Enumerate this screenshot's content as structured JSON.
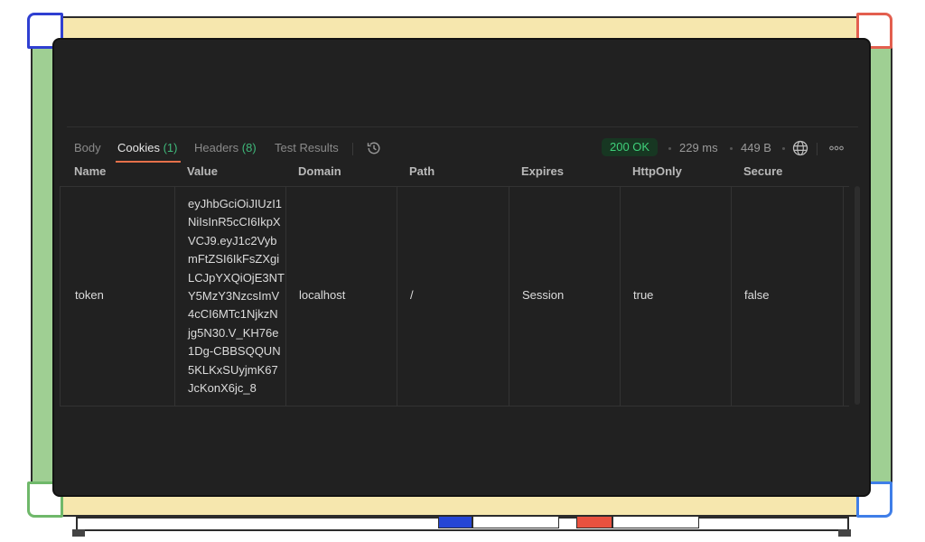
{
  "tabs": [
    {
      "label": "Body",
      "count": ""
    },
    {
      "label": "Cookies",
      "count": "(1)"
    },
    {
      "label": "Headers",
      "count": "(8)"
    },
    {
      "label": "Test Results",
      "count": ""
    }
  ],
  "response": {
    "status": "200 OK",
    "time": "229 ms",
    "size": "449 B"
  },
  "icons": {
    "history": "history-icon",
    "globe": "globe-icon",
    "more": "more-icon"
  },
  "colors": {
    "status_text": "#3fd07a",
    "status_bg": "#173722",
    "accent_underline": "#e5704a",
    "count": "#3fb87a"
  },
  "table": {
    "columns": [
      "Name",
      "Value",
      "Domain",
      "Path",
      "Expires",
      "HttpOnly",
      "Secure"
    ],
    "rows": [
      {
        "name": "token",
        "value_lines": [
          "eyJhbGciOiJIUzI1",
          "NiIsInR5cCI6IkpX",
          "VCJ9.eyJ1c2Vyb",
          "mFtZSI6IkFsZXgi",
          "LCJpYXQiOjE3NT",
          "Y5MzY3NzcsImV",
          "4cCI6MTc1NjkzN",
          "jg5N30.V_KH76e",
          "1Dg-CBBSQQUN",
          "5KLKxSUyjmK67",
          "JcKonX6jc_8"
        ],
        "domain": "localhost",
        "path": "/",
        "expires": "Session",
        "httponly": "true",
        "secure": "false"
      }
    ]
  }
}
